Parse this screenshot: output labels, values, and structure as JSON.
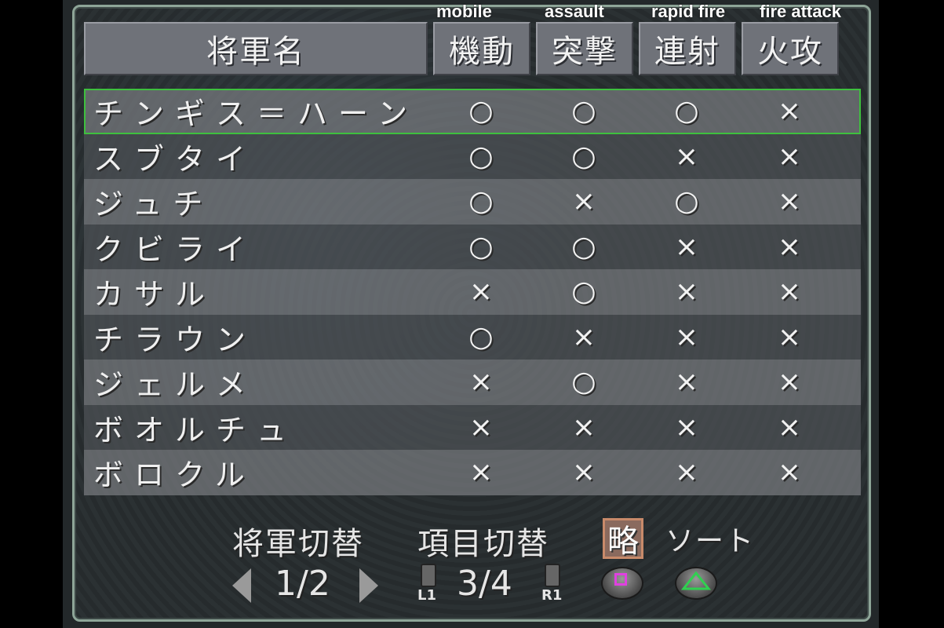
{
  "captions": {
    "mobile": "mobile",
    "assault": "assault",
    "rapid_fire": "rapid fire",
    "fire_attack": "fire attack"
  },
  "header": {
    "name_col": "将軍名",
    "col1": "機動",
    "col2": "突撃",
    "col3": "連射",
    "col4": "火攻"
  },
  "rows": [
    {
      "name": "チンギス＝ハーン",
      "c1": "○",
      "c2": "○",
      "c3": "○",
      "c4": "×"
    },
    {
      "name": "スブタイ",
      "c1": "○",
      "c2": "○",
      "c3": "×",
      "c4": "×"
    },
    {
      "name": "ジュチ",
      "c1": "○",
      "c2": "×",
      "c3": "○",
      "c4": "×"
    },
    {
      "name": "クビライ",
      "c1": "○",
      "c2": "○",
      "c3": "×",
      "c4": "×"
    },
    {
      "name": "カサル",
      "c1": "×",
      "c2": "○",
      "c3": "×",
      "c4": "×"
    },
    {
      "name": "チラウン",
      "c1": "○",
      "c2": "×",
      "c3": "×",
      "c4": "×"
    },
    {
      "name": "ジェルメ",
      "c1": "×",
      "c2": "○",
      "c3": "×",
      "c4": "×"
    },
    {
      "name": "ボオルチュ",
      "c1": "×",
      "c2": "×",
      "c3": "×",
      "c4": "×"
    },
    {
      "name": "ボロクル",
      "c1": "×",
      "c2": "×",
      "c3": "×",
      "c4": "×"
    }
  ],
  "footer": {
    "switch_general": "将軍切替",
    "switch_item": "項目切替",
    "abbr": "略",
    "sort": "ソート",
    "general_page": "1/2",
    "item_page": "3/4",
    "l1": "L1",
    "r1": "R1"
  },
  "icons": {
    "left": "triangle-left-icon",
    "right": "triangle-right-icon",
    "square": "square-button-icon",
    "triangle": "triangle-button-icon"
  },
  "colors": {
    "selection": "#3ec03e",
    "square": "#e040e0",
    "triangle": "#30d050"
  }
}
